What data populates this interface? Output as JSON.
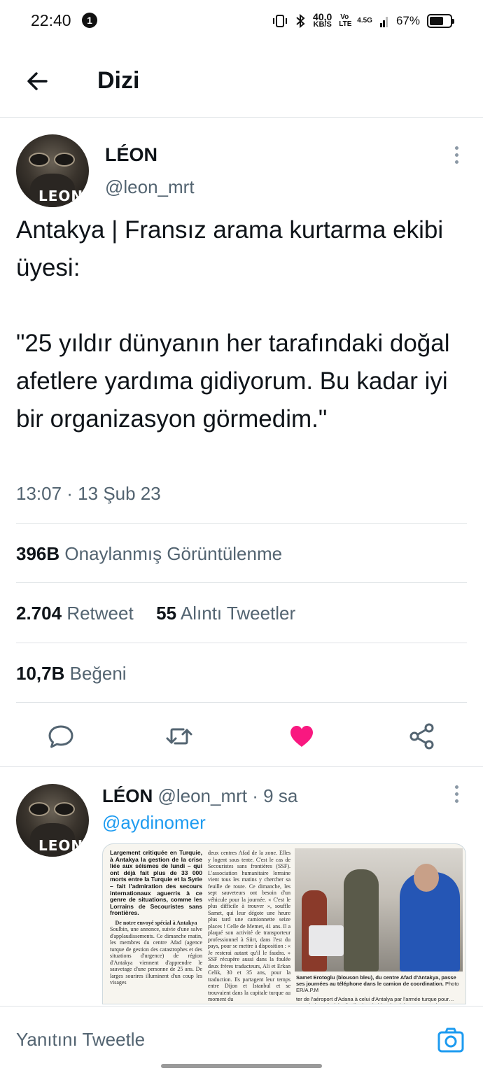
{
  "status_bar": {
    "time": "22:40",
    "notification_count": "1",
    "speed_value": "40,0",
    "speed_unit": "KB/S",
    "volte": "Vo LTE",
    "network": "4.5G",
    "battery": "67%",
    "battery_level": 0.67
  },
  "header": {
    "back_icon": "arrow-left-icon",
    "title": "Dizi"
  },
  "tweet": {
    "author_name": "LÉON",
    "author_handle": "@leon_mrt",
    "avatar_label": "LEON",
    "text": "Antakya | Fransız arama kurtarma ekibi üyesi:\n\n\"25 yıldır dünyanın her tarafındaki doğal afetlere yardıma gidiyorum. Bu kadar iyi bir organizasyon görmedim.\"",
    "timestamp": "13:07 · 13 Şub 23",
    "views_count": "396B",
    "views_label": "Onaylanmış Görüntülenme",
    "retweet_count": "2.704",
    "retweet_label": "Retweet",
    "quote_count": "55",
    "quote_label": "Alıntı Tweetler",
    "like_count": "10,7B",
    "like_label": "Beğeni",
    "liked": true,
    "like_color": "#f91880"
  },
  "actions": [
    "reply-icon",
    "retweet-icon",
    "like-icon",
    "share-icon"
  ],
  "reply": {
    "author_name": "LÉON",
    "author_handle": "@leon_mrt",
    "time_ago": "· 9 sa",
    "avatar_label": "LEON",
    "mention": "@aydinomer",
    "media": {
      "lead": "Largement critiquée en Turquie, à Antakya la gestion de la crise liée aux séismes de lundi – qui ont déjà fait plus de 33 000 morts entre la Turquie et la Syrie – fait l'admiration des secours internationaux aguerris à ce genre de situations, comme les Lorrains de Secouristes sans frontières.",
      "byline": "De notre envoyé spécial à Antakya",
      "col1_body": "Soulbin, une annonce, suivie d'une salve d'applaudissements. Ce dimanche matin, les membres du centre Afad (agence turque de gestion des catastrophes et des situations d'urgence) de région d'Antakya viennent d'apprendre le sauvetage d'une personne de 25 ans. De larges sourires illuminent d'un coup les visages",
      "col2_body": "deux centres Afad de la zone. Elles y logent sous tente. C'est le cas de Secouristes sans frontières (SSF). L'association humanitaire lorraine vient tous les matins y chercher sa feuille de route. Ce dimanche, les sept sauveteurs ont besoin d'un véhicule pour la journée. « C'est le plus difficile à trouver », souffle Samet, qui leur dégote une heure plus tard une camionnette seize places ! Celle de Memet, 41 ans. Il a plaqué son activité de transporteur professionnel à Siirt, dans l'est du pays, pour se mettre à disposition : « Je resterai autant qu'il le faudra. » SSF récupère aussi dans la foulée deux frères traducteurs, Ali et Erkan Celik, 30 et 35 ans, pour la traduction. Ils partagent leur temps entre Dijon et Istanbul et se trouvaient dans la capitale turque au moment du",
      "caption": "Samet Erotoglu (blouson bleu), du centre Afad d'Antakya, passe ses journées au téléphone dans le camion de coordination.",
      "photo_credit": "Photo ER/A.P.M",
      "caption_tail": "ter de l'aéroport d'Adana à celui d'Antalya par l'armée turque pour… toute la journée à la distribution de biscuits, thé, soupe et pain"
    }
  },
  "compose": {
    "placeholder": "Yanıtını Tweetle",
    "camera_icon": "camera-icon"
  }
}
